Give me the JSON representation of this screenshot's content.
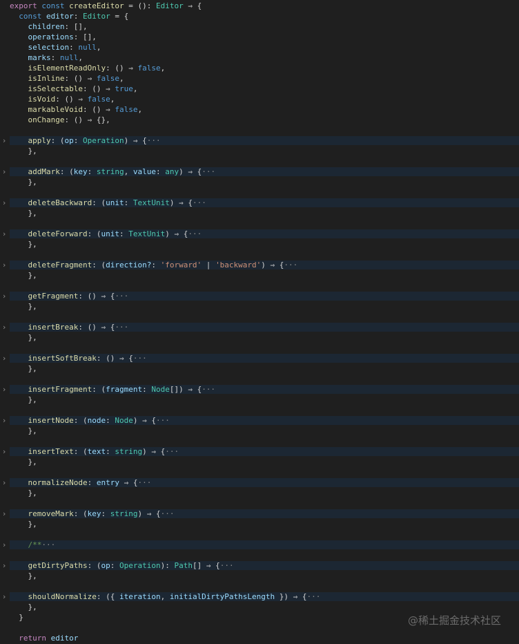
{
  "fold_icon": "chevron-right-icon",
  "watermark": "@稀土掘金技术社区",
  "lines": [
    {
      "folded": false,
      "tokens": [
        {
          "t": "export",
          "c": "kw"
        },
        {
          "t": " "
        },
        {
          "t": "const",
          "c": "kb"
        },
        {
          "t": " "
        },
        {
          "t": "createEditor",
          "c": "fn"
        },
        {
          "t": " = (): "
        },
        {
          "t": "Editor",
          "c": "ty"
        },
        {
          "t": " ⇒ {"
        }
      ]
    },
    {
      "folded": false,
      "tokens": [
        {
          "t": "  "
        },
        {
          "t": "const",
          "c": "kb"
        },
        {
          "t": " "
        },
        {
          "t": "editor",
          "c": "va"
        },
        {
          "t": ": "
        },
        {
          "t": "Editor",
          "c": "ty"
        },
        {
          "t": " = {"
        }
      ]
    },
    {
      "folded": false,
      "tokens": [
        {
          "t": "    "
        },
        {
          "t": "children",
          "c": "pr"
        },
        {
          "t": ": [],"
        }
      ]
    },
    {
      "folded": false,
      "tokens": [
        {
          "t": "    "
        },
        {
          "t": "operations",
          "c": "pr"
        },
        {
          "t": ": [],"
        }
      ]
    },
    {
      "folded": false,
      "tokens": [
        {
          "t": "    "
        },
        {
          "t": "selection",
          "c": "pr"
        },
        {
          "t": ": "
        },
        {
          "t": "null",
          "c": "kb"
        },
        {
          "t": ","
        }
      ]
    },
    {
      "folded": false,
      "tokens": [
        {
          "t": "    "
        },
        {
          "t": "marks",
          "c": "pr"
        },
        {
          "t": ": "
        },
        {
          "t": "null",
          "c": "kb"
        },
        {
          "t": ","
        }
      ]
    },
    {
      "folded": false,
      "tokens": [
        {
          "t": "    "
        },
        {
          "t": "isElementReadOnly",
          "c": "fn"
        },
        {
          "t": ": () ⇒ "
        },
        {
          "t": "false",
          "c": "kb"
        },
        {
          "t": ","
        }
      ]
    },
    {
      "folded": false,
      "tokens": [
        {
          "t": "    "
        },
        {
          "t": "isInline",
          "c": "fn"
        },
        {
          "t": ": () ⇒ "
        },
        {
          "t": "false",
          "c": "kb"
        },
        {
          "t": ","
        }
      ]
    },
    {
      "folded": false,
      "tokens": [
        {
          "t": "    "
        },
        {
          "t": "isSelectable",
          "c": "fn"
        },
        {
          "t": ": () ⇒ "
        },
        {
          "t": "true",
          "c": "kb"
        },
        {
          "t": ","
        }
      ]
    },
    {
      "folded": false,
      "tokens": [
        {
          "t": "    "
        },
        {
          "t": "isVoid",
          "c": "fn"
        },
        {
          "t": ": () ⇒ "
        },
        {
          "t": "false",
          "c": "kb"
        },
        {
          "t": ","
        }
      ]
    },
    {
      "folded": false,
      "tokens": [
        {
          "t": "    "
        },
        {
          "t": "markableVoid",
          "c": "fn"
        },
        {
          "t": ": () ⇒ "
        },
        {
          "t": "false",
          "c": "kb"
        },
        {
          "t": ","
        }
      ]
    },
    {
      "folded": false,
      "tokens": [
        {
          "t": "    "
        },
        {
          "t": "onChange",
          "c": "fn"
        },
        {
          "t": ": () ⇒ {},"
        }
      ]
    },
    {
      "folded": false,
      "tokens": []
    },
    {
      "folded": true,
      "tokens": [
        {
          "t": "    "
        },
        {
          "t": "apply",
          "c": "fn"
        },
        {
          "t": ": ("
        },
        {
          "t": "op",
          "c": "va"
        },
        {
          "t": ": "
        },
        {
          "t": "Operation",
          "c": "ty"
        },
        {
          "t": ") ⇒ {"
        },
        {
          "t": "···",
          "c": "ellipsis"
        }
      ]
    },
    {
      "folded": false,
      "tokens": [
        {
          "t": "    },"
        }
      ]
    },
    {
      "folded": false,
      "tokens": []
    },
    {
      "folded": true,
      "tokens": [
        {
          "t": "    "
        },
        {
          "t": "addMark",
          "c": "fn"
        },
        {
          "t": ": ("
        },
        {
          "t": "key",
          "c": "va"
        },
        {
          "t": ": "
        },
        {
          "t": "string",
          "c": "ty"
        },
        {
          "t": ", "
        },
        {
          "t": "value",
          "c": "va"
        },
        {
          "t": ": "
        },
        {
          "t": "any",
          "c": "ty"
        },
        {
          "t": ") ⇒ {"
        },
        {
          "t": "···",
          "c": "ellipsis"
        }
      ]
    },
    {
      "folded": false,
      "tokens": [
        {
          "t": "    },"
        }
      ]
    },
    {
      "folded": false,
      "tokens": []
    },
    {
      "folded": true,
      "tokens": [
        {
          "t": "    "
        },
        {
          "t": "deleteBackward",
          "c": "fn"
        },
        {
          "t": ": ("
        },
        {
          "t": "unit",
          "c": "va"
        },
        {
          "t": ": "
        },
        {
          "t": "TextUnit",
          "c": "ty"
        },
        {
          "t": ") ⇒ {"
        },
        {
          "t": "···",
          "c": "ellipsis"
        }
      ]
    },
    {
      "folded": false,
      "tokens": [
        {
          "t": "    },"
        }
      ]
    },
    {
      "folded": false,
      "tokens": []
    },
    {
      "folded": true,
      "tokens": [
        {
          "t": "    "
        },
        {
          "t": "deleteForward",
          "c": "fn"
        },
        {
          "t": ": ("
        },
        {
          "t": "unit",
          "c": "va"
        },
        {
          "t": ": "
        },
        {
          "t": "TextUnit",
          "c": "ty"
        },
        {
          "t": ") ⇒ {"
        },
        {
          "t": "···",
          "c": "ellipsis"
        }
      ]
    },
    {
      "folded": false,
      "tokens": [
        {
          "t": "    },"
        }
      ]
    },
    {
      "folded": false,
      "tokens": []
    },
    {
      "folded": true,
      "tokens": [
        {
          "t": "    "
        },
        {
          "t": "deleteFragment",
          "c": "fn"
        },
        {
          "t": ": ("
        },
        {
          "t": "direction?",
          "c": "va"
        },
        {
          "t": ": "
        },
        {
          "t": "'forward'",
          "c": "st"
        },
        {
          "t": " | "
        },
        {
          "t": "'backward'",
          "c": "st"
        },
        {
          "t": ") ⇒ {"
        },
        {
          "t": "···",
          "c": "ellipsis"
        }
      ]
    },
    {
      "folded": false,
      "tokens": [
        {
          "t": "    },"
        }
      ]
    },
    {
      "folded": false,
      "tokens": []
    },
    {
      "folded": true,
      "tokens": [
        {
          "t": "    "
        },
        {
          "t": "getFragment",
          "c": "fn"
        },
        {
          "t": ": () ⇒ {"
        },
        {
          "t": "···",
          "c": "ellipsis"
        }
      ]
    },
    {
      "folded": false,
      "tokens": [
        {
          "t": "    },"
        }
      ]
    },
    {
      "folded": false,
      "tokens": []
    },
    {
      "folded": true,
      "tokens": [
        {
          "t": "    "
        },
        {
          "t": "insertBreak",
          "c": "fn"
        },
        {
          "t": ": () ⇒ {"
        },
        {
          "t": "···",
          "c": "ellipsis"
        }
      ]
    },
    {
      "folded": false,
      "tokens": [
        {
          "t": "    },"
        }
      ]
    },
    {
      "folded": false,
      "tokens": []
    },
    {
      "folded": true,
      "tokens": [
        {
          "t": "    "
        },
        {
          "t": "insertSoftBreak",
          "c": "fn"
        },
        {
          "t": ": () ⇒ {"
        },
        {
          "t": "···",
          "c": "ellipsis"
        }
      ]
    },
    {
      "folded": false,
      "tokens": [
        {
          "t": "    },"
        }
      ]
    },
    {
      "folded": false,
      "tokens": []
    },
    {
      "folded": true,
      "tokens": [
        {
          "t": "    "
        },
        {
          "t": "insertFragment",
          "c": "fn"
        },
        {
          "t": ": ("
        },
        {
          "t": "fragment",
          "c": "va"
        },
        {
          "t": ": "
        },
        {
          "t": "Node",
          "c": "ty"
        },
        {
          "t": "[]) ⇒ {"
        },
        {
          "t": "···",
          "c": "ellipsis"
        }
      ]
    },
    {
      "folded": false,
      "tokens": [
        {
          "t": "    },"
        }
      ]
    },
    {
      "folded": false,
      "tokens": []
    },
    {
      "folded": true,
      "tokens": [
        {
          "t": "    "
        },
        {
          "t": "insertNode",
          "c": "fn"
        },
        {
          "t": ": ("
        },
        {
          "t": "node",
          "c": "va"
        },
        {
          "t": ": "
        },
        {
          "t": "Node",
          "c": "ty"
        },
        {
          "t": ") ⇒ {"
        },
        {
          "t": "···",
          "c": "ellipsis"
        }
      ]
    },
    {
      "folded": false,
      "tokens": [
        {
          "t": "    },"
        }
      ]
    },
    {
      "folded": false,
      "tokens": []
    },
    {
      "folded": true,
      "tokens": [
        {
          "t": "    "
        },
        {
          "t": "insertText",
          "c": "fn"
        },
        {
          "t": ": ("
        },
        {
          "t": "text",
          "c": "va"
        },
        {
          "t": ": "
        },
        {
          "t": "string",
          "c": "ty"
        },
        {
          "t": ") ⇒ {"
        },
        {
          "t": "···",
          "c": "ellipsis"
        }
      ]
    },
    {
      "folded": false,
      "tokens": [
        {
          "t": "    },"
        }
      ]
    },
    {
      "folded": false,
      "tokens": []
    },
    {
      "folded": true,
      "tokens": [
        {
          "t": "    "
        },
        {
          "t": "normalizeNode",
          "c": "fn"
        },
        {
          "t": ": "
        },
        {
          "t": "entry",
          "c": "va"
        },
        {
          "t": " ⇒ {"
        },
        {
          "t": "···",
          "c": "ellipsis"
        }
      ]
    },
    {
      "folded": false,
      "tokens": [
        {
          "t": "    },"
        }
      ]
    },
    {
      "folded": false,
      "tokens": []
    },
    {
      "folded": true,
      "tokens": [
        {
          "t": "    "
        },
        {
          "t": "removeMark",
          "c": "fn"
        },
        {
          "t": ": ("
        },
        {
          "t": "key",
          "c": "va"
        },
        {
          "t": ": "
        },
        {
          "t": "string",
          "c": "ty"
        },
        {
          "t": ") ⇒ {"
        },
        {
          "t": "···",
          "c": "ellipsis"
        }
      ]
    },
    {
      "folded": false,
      "tokens": [
        {
          "t": "    },"
        }
      ]
    },
    {
      "folded": false,
      "tokens": []
    },
    {
      "folded": true,
      "tokens": [
        {
          "t": "    "
        },
        {
          "t": "/**",
          "c": "cm"
        },
        {
          "t": "···",
          "c": "ellipsis"
        }
      ]
    },
    {
      "folded": false,
      "tokens": []
    },
    {
      "folded": true,
      "tokens": [
        {
          "t": "    "
        },
        {
          "t": "getDirtyPaths",
          "c": "fn"
        },
        {
          "t": ": ("
        },
        {
          "t": "op",
          "c": "va"
        },
        {
          "t": ": "
        },
        {
          "t": "Operation",
          "c": "ty"
        },
        {
          "t": "): "
        },
        {
          "t": "Path",
          "c": "ty"
        },
        {
          "t": "[] ⇒ {"
        },
        {
          "t": "···",
          "c": "ellipsis"
        }
      ]
    },
    {
      "folded": false,
      "tokens": [
        {
          "t": "    },"
        }
      ]
    },
    {
      "folded": false,
      "tokens": []
    },
    {
      "folded": true,
      "tokens": [
        {
          "t": "    "
        },
        {
          "t": "shouldNormalize",
          "c": "fn"
        },
        {
          "t": ": ({ "
        },
        {
          "t": "iteration",
          "c": "va"
        },
        {
          "t": ", "
        },
        {
          "t": "initialDirtyPathsLength",
          "c": "va"
        },
        {
          "t": " }) ⇒ {"
        },
        {
          "t": "···",
          "c": "ellipsis"
        }
      ]
    },
    {
      "folded": false,
      "tokens": [
        {
          "t": "    },"
        }
      ]
    },
    {
      "folded": false,
      "tokens": [
        {
          "t": "  }"
        }
      ]
    },
    {
      "folded": false,
      "tokens": []
    },
    {
      "folded": false,
      "tokens": [
        {
          "t": "  "
        },
        {
          "t": "return",
          "c": "kw"
        },
        {
          "t": " "
        },
        {
          "t": "editor",
          "c": "va"
        }
      ]
    }
  ]
}
